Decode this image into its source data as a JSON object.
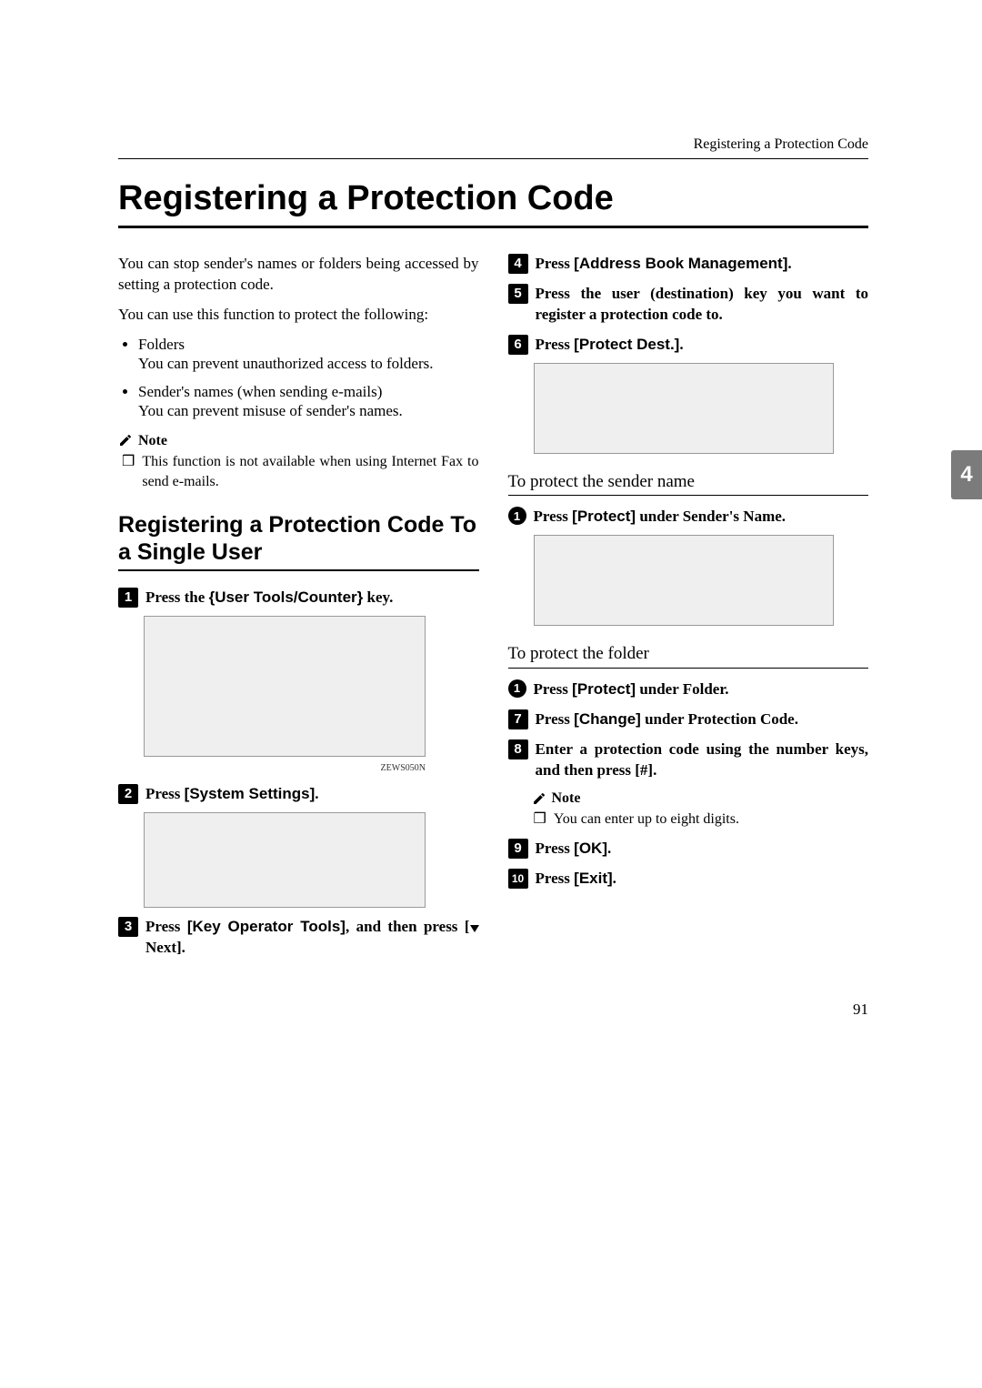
{
  "runningHeader": "Registering a Protection Code",
  "title": "Registering a Protection Code",
  "intro1": "You can stop sender's names or folders being accessed by setting a protection code.",
  "intro2": "You can use this function to protect the following:",
  "bullets": {
    "b1": "Folders",
    "b1desc": "You can prevent unauthorized access to folders.",
    "b2": "Sender's names (when sending e-mails)",
    "b2desc": "You can prevent misuse of sender's names."
  },
  "noteLabel": "Note",
  "note1": "This function is not available when using Internet Fax to send e-mails.",
  "subhead": "Registering a Protection Code To a Single User",
  "step1_a": "Press the ",
  "step1_key": "User Tools/Counter",
  "step1_b": " key.",
  "figureCap1": "ZEWS050N",
  "step2_a": "Press ",
  "step2_btn": "[System Settings]",
  "step2_b": ".",
  "step3_a": "Press ",
  "step3_btn": "[Key Operator Tools]",
  "step3_mid": ", and then press [",
  "step3_next": "Next]",
  "step3_end": ".",
  "step4_a": "Press ",
  "step4_btn": "[Address Book Management]",
  "step4_b": ".",
  "step5": "Press the user (destination) key you want to register a protection code to.",
  "step6_a": "Press ",
  "step6_btn": "[Protect Dest.]",
  "step6_b": ".",
  "sub1": "To protect the sender name",
  "sub1_step_a": "Press ",
  "sub1_step_btn": "[Protect]",
  "sub1_step_b": " under Sender's Name.",
  "sub2": "To protect the folder",
  "sub2_step_a": "Press ",
  "sub2_step_btn": "[Protect]",
  "sub2_step_b": " under Folder.",
  "step7_a": "Press ",
  "step7_btn": "[Change]",
  "step7_b": " under Protection Code.",
  "step8": "Enter a protection code using the number keys, and then press [#].",
  "note2": "You can enter up to eight digits.",
  "step9_a": "Press ",
  "step9_btn": "[OK]",
  "step9_b": ".",
  "step10_a": "Press ",
  "step10_btn": "[Exit]",
  "step10_b": ".",
  "tabNum": "4",
  "pageNum": "91"
}
